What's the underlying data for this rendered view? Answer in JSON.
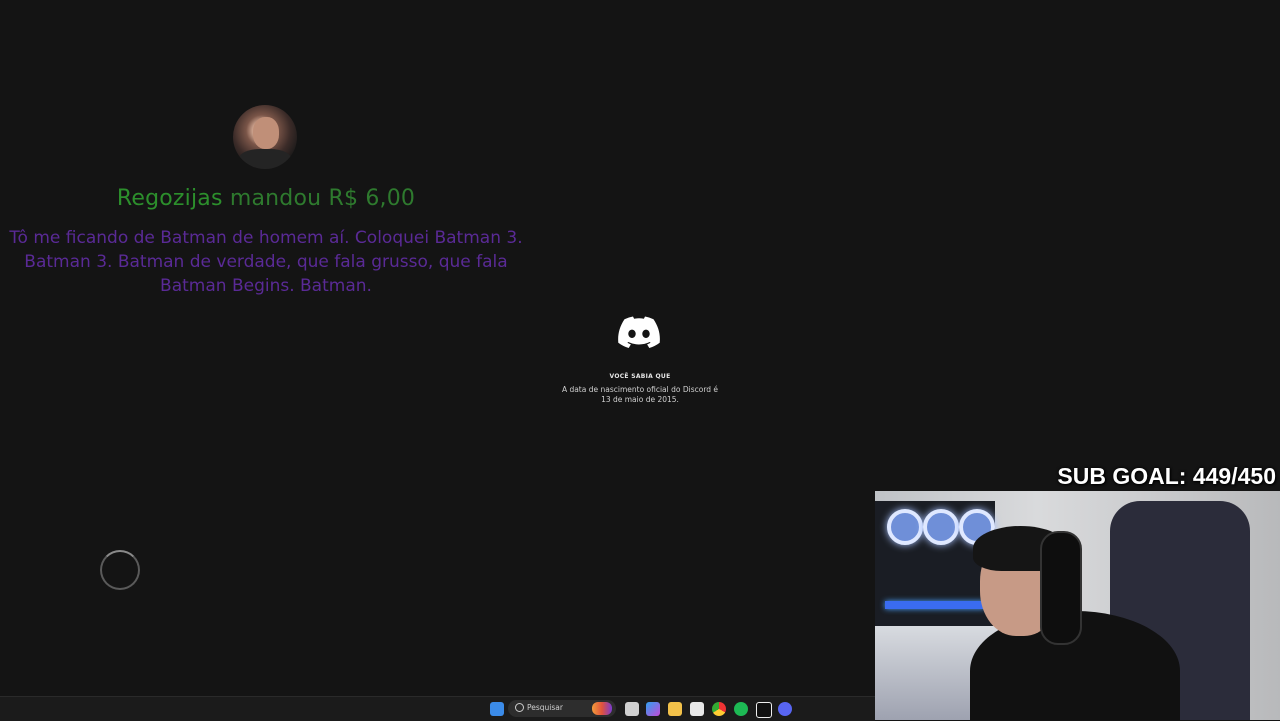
{
  "alert": {
    "donor": "Regozijas",
    "action": "mandou",
    "amount": "R$ 6,00",
    "message": "Tô me ficando de Batman de homem aí. Coloquei Batman 3. Batman 3. Batman de verdade, que fala grusso, que fala Batman Begins. Batman."
  },
  "discord": {
    "tip_title": "VOCÊ SABIA QUE",
    "tip_text": "A data de nascimento oficial do Discord é 13 de maio de 2015."
  },
  "overlay": {
    "sub_goal": "SUB GOAL: 449/450"
  },
  "taskbar": {
    "search_label": "Pesquisar",
    "icons": [
      "windows-start-icon",
      "search-icon",
      "task-view-icon",
      "copilot-icon",
      "file-explorer-icon",
      "store-icon",
      "chrome-icon",
      "spotify-icon",
      "capcut-icon",
      "discord-icon"
    ]
  },
  "colors": {
    "background": "#141414",
    "donor": "#2c8f2c",
    "message": "#5a2a96",
    "discord_accent": "#5865f2"
  }
}
